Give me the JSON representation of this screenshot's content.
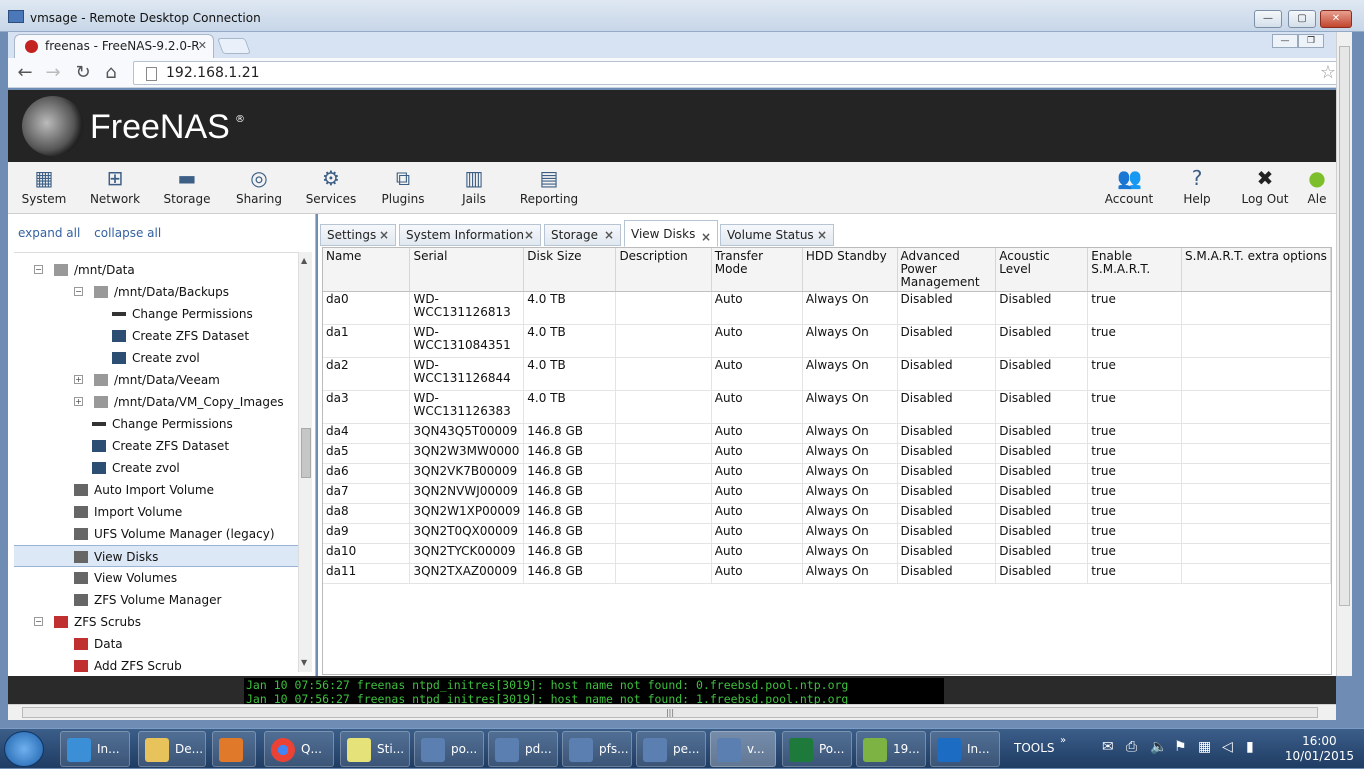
{
  "rdp": {
    "title": "vmsage - Remote Desktop Connection"
  },
  "browser": {
    "tab_title": "freenas - FreeNAS-9.2.0-R",
    "url": "192.168.1.21"
  },
  "freenas": {
    "brand": "FreeNAS",
    "nav_left": [
      "System",
      "Network",
      "Storage",
      "Sharing",
      "Services",
      "Plugins",
      "Jails",
      "Reporting"
    ],
    "nav_right": [
      "Account",
      "Help",
      "Log Out",
      "Ale"
    ]
  },
  "left": {
    "expand_all": "expand all",
    "collapse_all": "collapse all",
    "tree": [
      "/mnt/Data",
      "/mnt/Data/Backups",
      "Change Permissions",
      "Create ZFS Dataset",
      "Create zvol",
      "/mnt/Data/Veeam",
      "/mnt/Data/VM_Copy_Images",
      "Change Permissions",
      "Create ZFS Dataset",
      "Create zvol",
      "Auto Import Volume",
      "Import Volume",
      "UFS Volume Manager (legacy)",
      "View Disks",
      "View Volumes",
      "ZFS Volume Manager",
      "ZFS Scrubs",
      "Data",
      "Add ZFS Scrub"
    ]
  },
  "tabs": [
    "Settings",
    "System Information",
    "Storage",
    "View Disks",
    "Volume Status"
  ],
  "disks": {
    "headers": [
      "Name",
      "Serial",
      "Disk Size",
      "Description",
      "Transfer Mode",
      "HDD Standby",
      "Advanced Power Management",
      "Acoustic Level",
      "Enable S.M.A.R.T.",
      "S.M.A.R.T. extra options"
    ],
    "rows": [
      [
        "da0",
        "WD-WCC131126813",
        "4.0 TB",
        "",
        "Auto",
        "Always On",
        "Disabled",
        "Disabled",
        "true",
        ""
      ],
      [
        "da1",
        "WD-WCC131084351",
        "4.0 TB",
        "",
        "Auto",
        "Always On",
        "Disabled",
        "Disabled",
        "true",
        ""
      ],
      [
        "da2",
        "WD-WCC131126844",
        "4.0 TB",
        "",
        "Auto",
        "Always On",
        "Disabled",
        "Disabled",
        "true",
        ""
      ],
      [
        "da3",
        "WD-WCC131126383",
        "4.0 TB",
        "",
        "Auto",
        "Always On",
        "Disabled",
        "Disabled",
        "true",
        ""
      ],
      [
        "da4",
        "3QN43Q5T00009",
        "146.8 GB",
        "",
        "Auto",
        "Always On",
        "Disabled",
        "Disabled",
        "true",
        ""
      ],
      [
        "da5",
        "3QN2W3MW0000",
        "146.8 GB",
        "",
        "Auto",
        "Always On",
        "Disabled",
        "Disabled",
        "true",
        ""
      ],
      [
        "da6",
        "3QN2VK7B00009",
        "146.8 GB",
        "",
        "Auto",
        "Always On",
        "Disabled",
        "Disabled",
        "true",
        ""
      ],
      [
        "da7",
        "3QN2NVWJ00009",
        "146.8 GB",
        "",
        "Auto",
        "Always On",
        "Disabled",
        "Disabled",
        "true",
        ""
      ],
      [
        "da8",
        "3QN2W1XP00009",
        "146.8 GB",
        "",
        "Auto",
        "Always On",
        "Disabled",
        "Disabled",
        "true",
        ""
      ],
      [
        "da9",
        "3QN2T0QX00009",
        "146.8 GB",
        "",
        "Auto",
        "Always On",
        "Disabled",
        "Disabled",
        "true",
        ""
      ],
      [
        "da10",
        "3QN2TYCK00009",
        "146.8 GB",
        "",
        "Auto",
        "Always On",
        "Disabled",
        "Disabled",
        "true",
        ""
      ],
      [
        "da11",
        "3QN2TXAZ00009",
        "146.8 GB",
        "",
        "Auto",
        "Always On",
        "Disabled",
        "Disabled",
        "true",
        ""
      ]
    ]
  },
  "console": {
    "line1": "Jan 10 07:56:27 freenas ntpd_initres[3019]: host name not found: 0.freebsd.pool.ntp.org",
    "line2": "Jan 10 07:56:27 freenas ntpd_initres[3019]: host name not found: 1.freebsd.pool.ntp.org"
  },
  "taskbar": {
    "items": [
      "In...",
      "De...",
      "",
      "Q...",
      "Sti...",
      "po...",
      "pd...",
      "pfs...",
      "pe...",
      "v...",
      "Po...",
      "19...",
      "In..."
    ],
    "tools": "TOOLS",
    "time": "16:00",
    "date": "10/01/2015"
  },
  "colors": {
    "brand_header": "#242424",
    "link": "#3462a0",
    "console_text": "#3fbf3f",
    "selected_row": "#dde8f6"
  }
}
